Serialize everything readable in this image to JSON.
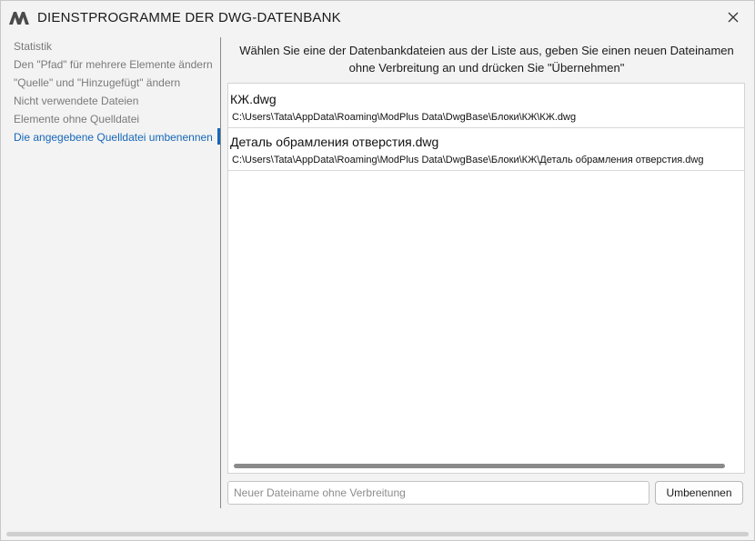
{
  "window": {
    "title": "DIENSTPROGRAMME DER DWG-DATENBANK",
    "logo_icon": "modplus-logo-icon",
    "close_icon": "close-icon",
    "accent_color": "#1667b8"
  },
  "sidebar": {
    "items": [
      {
        "label": "Statistik",
        "active": false
      },
      {
        "label": "Den \"Pfad\" für mehrere Elemente ändern",
        "active": false
      },
      {
        "label": "\"Quelle\" und \"Hinzugefügt\" ändern",
        "active": false
      },
      {
        "label": "Nicht verwendete Dateien",
        "active": false
      },
      {
        "label": "Elemente ohne Quelldatei",
        "active": false
      },
      {
        "label": "Die angegebene Quelldatei umbenennen",
        "active": true
      }
    ]
  },
  "main": {
    "instruction": "Wählen Sie eine der Datenbankdateien aus der Liste aus, geben Sie einen neuen Dateinamen ohne Verbreitung an und drücken Sie \"Übernehmen\"",
    "files": [
      {
        "name": "КЖ.dwg",
        "path": "C:\\Users\\Tata\\AppData\\Roaming\\ModPlus Data\\DwgBase\\Блоки\\КЖ\\КЖ.dwg"
      },
      {
        "name": "Деталь обрамления отверстия.dwg",
        "path": "C:\\Users\\Tata\\AppData\\Roaming\\ModPlus Data\\DwgBase\\Блоки\\КЖ\\Деталь обрамления отверстия.dwg"
      }
    ],
    "new_name_input": {
      "value": "",
      "placeholder": "Neuer Dateiname ohne Verbreitung"
    },
    "rename_button": "Umbenennen"
  }
}
